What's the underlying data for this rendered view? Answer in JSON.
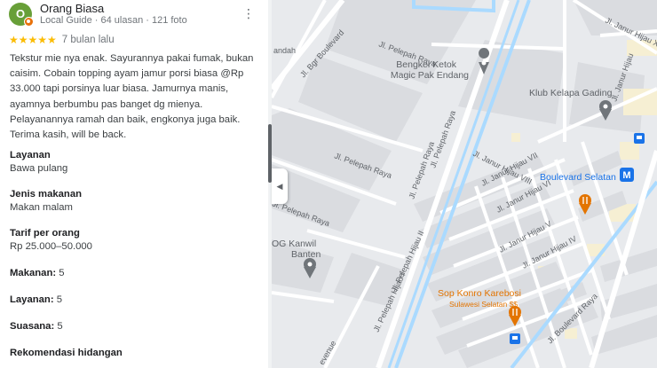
{
  "review": {
    "avatar_letter": "O",
    "name": "Orang Biasa",
    "meta": "Local Guide · 64 ulasan · 121 foto",
    "stars": "★★★★★",
    "rating": 5,
    "time": "7 bulan lalu",
    "text": "Tekstur mie nya enak. Sayurannya pakai fumak, bukan caisim. Cobain topping ayam jamur porsi biasa @Rp 33.000 tapi porsinya luar biasa. Jamurnya manis, ayamnya berbumbu pas banget dg mienya. Pelayanannya ramah dan baik, engkonya juga baik. Terima kasih, will be back.",
    "more_icon": "⋮"
  },
  "attributes": [
    {
      "label": "Layanan",
      "value": "Bawa pulang"
    },
    {
      "label": "Jenis makanan",
      "value": "Makan malam"
    },
    {
      "label": "Tarif per orang",
      "value": "Rp 25.000–50.000"
    }
  ],
  "ratings": [
    {
      "label": "Makanan:",
      "value": "5"
    },
    {
      "label": "Layanan:",
      "value": "5"
    },
    {
      "label": "Suasana:",
      "value": "5"
    }
  ],
  "recommend_label": "Rekomendasi hidangan",
  "collapse_icon": "◀",
  "map": {
    "roads": {
      "bgr_boulevard": "Jl. Bgr Boulevard",
      "pelepah_raya_1": "Jl. Pelepah Raya",
      "pelepah_raya_2": "Jl. Pelepah Raya",
      "pelepah_raya_3": "Jl. Pelepah Raya",
      "pelepah_raya_4": "Jl. Pelepah Raya",
      "pelepah_raya_5": "Jl. Pelepah Raya",
      "pelepah_raya_6": "Jl. Pelepah Raya",
      "janur_hijau_x": "Jl. Janur Hijau X",
      "janur_hijau_viii": "Jl. Janur Hijau VIII",
      "janur_hijau_vii": "Jl. Janur Hijau VII",
      "janur_hijau_vi": "Jl. Janur Hijau VI",
      "janur_hijau_v": "Jl. Janur Hijau V",
      "janur_hijau_iv": "Jl. Janur Hijau IV",
      "pelepah_hijau_i": "Jl. Pelepah Hijau I",
      "pelepah_hijau_ii": "Jl. Pelepah Hijau II",
      "boulevard_raya": "Jl. Boulevard Raya",
      "janur_top": "Jl. Janur Hijau",
      "pandah": "andah",
      "venue": "evenue"
    },
    "pois": {
      "bengkel_1": "Bengkel Ketok",
      "bengkel_2": "Magic Pak Endang",
      "klub": "Klub Kelapa Gading",
      "boulevard_selatan": "Boulevard Selatan",
      "kanwil_1": "OG Kanwil",
      "kanwil_2": "Banten",
      "sop_1": "Sop Konro Karebosi",
      "sop_2": "Sulawesi Selatan $$",
      "metro_letter": "M"
    },
    "colors": {
      "road": "#ffffff",
      "block": "#dadce0",
      "main_road": "#aadaff",
      "poi_orange": "#e37400",
      "poi_blue": "#1a73e8",
      "pin_gray": "#70757a"
    }
  }
}
